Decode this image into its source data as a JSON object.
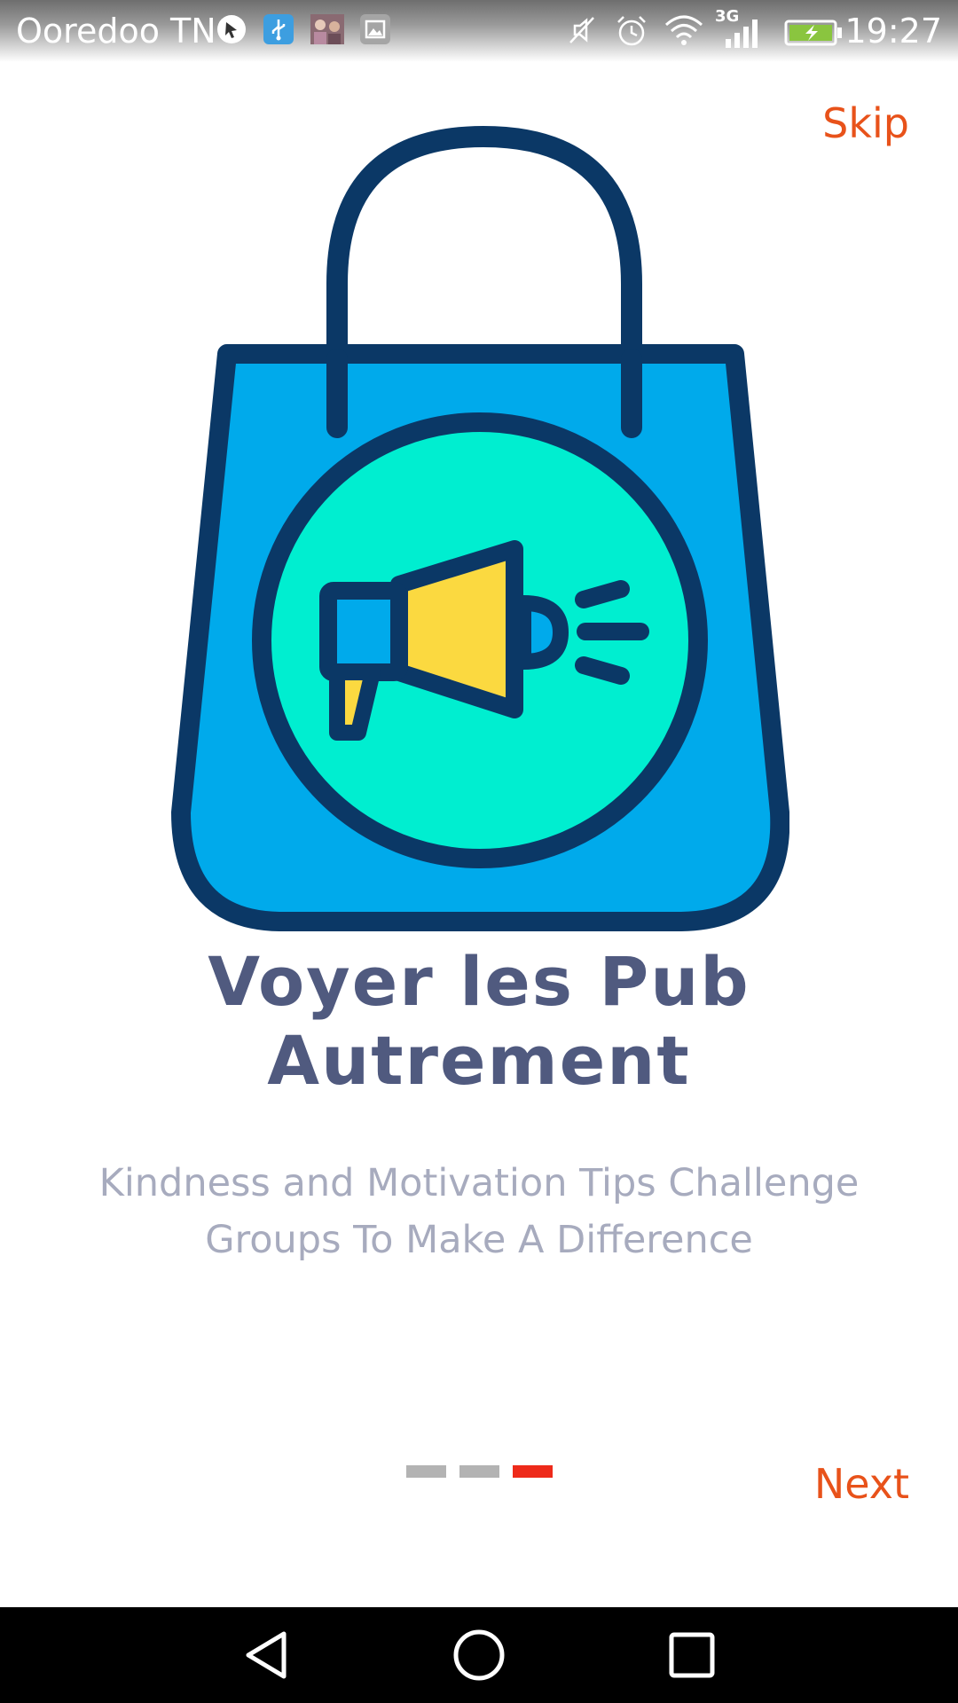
{
  "status_bar": {
    "carrier": "Ooredoo TN",
    "network_type": "3G",
    "time": "19:27",
    "icons": [
      "cursor-notification-icon",
      "usb-icon",
      "photo-thumbnail-icon",
      "gallery-icon",
      "mute-icon",
      "alarm-icon",
      "wifi-icon",
      "signal-icon",
      "battery-charging-icon"
    ]
  },
  "header": {
    "skip_label": "Skip"
  },
  "main": {
    "illustration_icon": "shopping-bag-megaphone-icon",
    "title": "Voyer les Pub Autrement",
    "subtitle": "Kindness and Motivation Tips Challenge Groups To Make A Difference"
  },
  "pager": {
    "total": 3,
    "current": 3
  },
  "footer": {
    "next_label": "Next"
  },
  "nav_bar": {
    "icons": [
      "back-icon",
      "home-icon",
      "recents-icon"
    ]
  },
  "colors": {
    "accent": "#e8521a",
    "title": "#505a7f",
    "subtitle": "#a7abbe",
    "dot_inactive": "#b3b3b3",
    "dot_active": "#ee2a1a",
    "bag": "#00aaeb",
    "bag_outline": "#0b3866",
    "circle": "#00eed0",
    "megaphone": "#fbd940"
  }
}
